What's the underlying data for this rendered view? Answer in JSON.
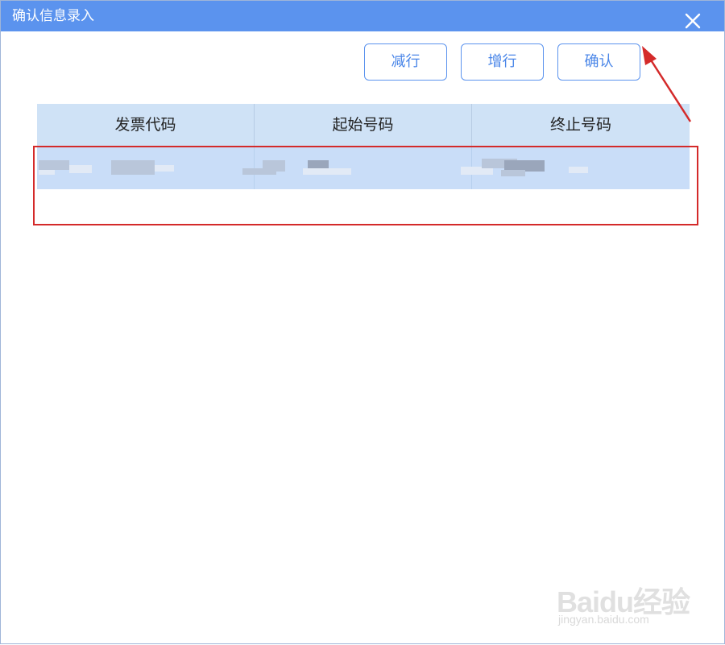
{
  "window": {
    "title": "确认信息录入",
    "close_icon": "close-icon"
  },
  "toolbar": {
    "remove_row_label": "减行",
    "add_row_label": "增行",
    "confirm_label": "确认"
  },
  "table": {
    "columns": [
      "发票代码",
      "起始号码",
      "终止号码"
    ],
    "rows": [
      {
        "invoice_code": "",
        "start_number": "",
        "end_number": ""
      }
    ]
  },
  "colors": {
    "titlebar": "#5b93ee",
    "button_border": "#5b93ee",
    "header_bg": "#cfe2f6",
    "selected_row_bg": "#c9ddf8",
    "annotation_red": "#d42a2a"
  },
  "watermark": {
    "brand": "Baidu经验",
    "url": "jingyan.baidu.com"
  }
}
